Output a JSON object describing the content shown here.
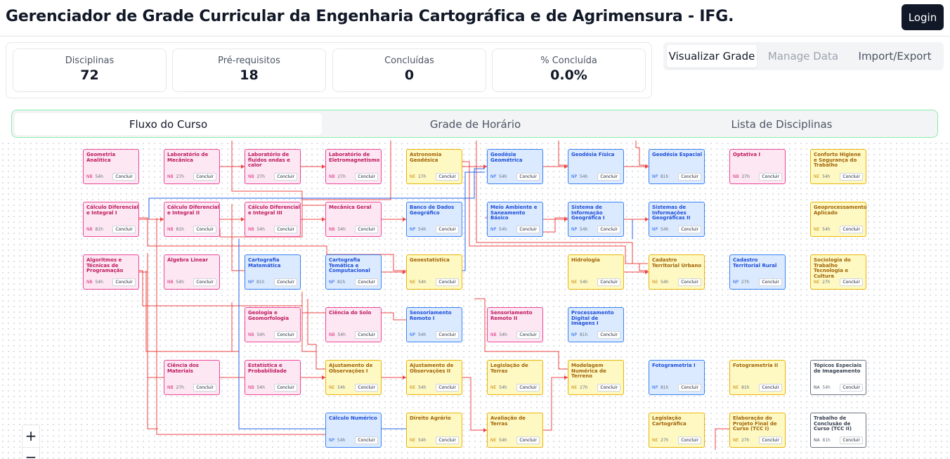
{
  "header": {
    "title": "Gerenciador de Grade Curricular da Engenharia Cartográfica e de Agrimensura - IFG.",
    "login_label": "Login"
  },
  "stats": [
    {
      "label": "Disciplinas",
      "value": "72"
    },
    {
      "label": "Pré-requisitos",
      "value": "18"
    },
    {
      "label": "Concluídas",
      "value": "0"
    },
    {
      "label": "% Concluída",
      "value": "0.0%"
    }
  ],
  "top_tabs": [
    {
      "label": "Visualizar Grade",
      "state": "active"
    },
    {
      "label": "Manage Data",
      "state": "disabled"
    },
    {
      "label": "Import/Export",
      "state": "normal"
    }
  ],
  "sub_tabs": [
    {
      "label": "Fluxo do Curso",
      "active": true
    },
    {
      "label": "Grade de Horário",
      "active": false
    },
    {
      "label": "Lista de Disciplinas",
      "active": false
    }
  ],
  "node_button_label": "Concluir",
  "zoom": {
    "in_label": "+",
    "out_label": "−"
  },
  "colors": {
    "NB": "#ec4899",
    "NP": "#3b82f6",
    "NE": "#eab308",
    "NA": "#6b7280",
    "edge_red": "#ef4444",
    "edge_blue": "#2563eb"
  },
  "columns": [
    [
      {
        "row": 0,
        "name": "Geometria Analítica",
        "code": "NB",
        "hours": "54h"
      },
      {
        "row": 1,
        "name": "Cálculo Diferencial e Integral I",
        "code": "NB",
        "hours": "81h"
      },
      {
        "row": 2,
        "name": "Algoritmos e Técnicas de Programação",
        "code": "NB",
        "hours": "54h"
      }
    ],
    [
      {
        "row": 0,
        "name": "Laboratório de Mecânica",
        "code": "NB",
        "hours": "27h"
      },
      {
        "row": 1,
        "name": "Cálculo Diferencial e Integral II",
        "code": "NB",
        "hours": "81h"
      },
      {
        "row": 2,
        "name": "Álgebra Linear",
        "code": "NB",
        "hours": "54h"
      },
      {
        "row": 4,
        "name": "Ciência dos Materiais",
        "code": "NB",
        "hours": "27h"
      }
    ],
    [
      {
        "row": 0,
        "name": "Laboratório de fluidos ondas e calor",
        "code": "NB",
        "hours": "27h"
      },
      {
        "row": 1,
        "name": "Cálculo Diferencial e Integral III",
        "code": "NB",
        "hours": "54h"
      },
      {
        "row": 2,
        "name": "Cartografia Matemática",
        "code": "NP",
        "hours": "81h"
      },
      {
        "row": 3,
        "name": "Geologia e Geomorfologia",
        "code": "NB",
        "hours": "54h"
      },
      {
        "row": 4,
        "name": "Estatística e Probabilidade",
        "code": "NB",
        "hours": "54h"
      }
    ],
    [
      {
        "row": 0,
        "name": "Laboratório de Eletromagnetismo",
        "code": "NB",
        "hours": "27h"
      },
      {
        "row": 1,
        "name": "Mecânica Geral",
        "code": "NB",
        "hours": "54h"
      },
      {
        "row": 2,
        "name": "Cartografia Temática e Computacional",
        "code": "NP",
        "hours": "81h"
      },
      {
        "row": 3,
        "name": "Ciência do Solo",
        "code": "NB",
        "hours": "54h"
      },
      {
        "row": 4,
        "name": "Ajustamento de Observações I",
        "code": "NE",
        "hours": "54h"
      },
      {
        "row": 5,
        "name": "Cálculo Numérico",
        "code": "NP",
        "hours": "54h"
      }
    ],
    [
      {
        "row": 0,
        "name": "Astronomia Geodésica",
        "code": "NE",
        "hours": "27h"
      },
      {
        "row": 1,
        "name": "Banco de Dados Geográfico",
        "code": "NP",
        "hours": "54h"
      },
      {
        "row": 2,
        "name": "Geoestatística",
        "code": "NE",
        "hours": "54h"
      },
      {
        "row": 3,
        "name": "Sensoriamento Remoto I",
        "code": "NP",
        "hours": "54h"
      },
      {
        "row": 4,
        "name": "Ajustamento de Observações II",
        "code": "NE",
        "hours": "54h"
      },
      {
        "row": 5,
        "name": "Direito Agrário",
        "code": "NE",
        "hours": "54h"
      }
    ],
    [
      {
        "row": 0,
        "name": "Geodésia Geométrica",
        "code": "NP",
        "hours": "54h"
      },
      {
        "row": 1,
        "name": "Meio Ambiente e Saneamento Básico",
        "code": "NP",
        "hours": "54h"
      },
      {
        "row": 3,
        "name": "Sensoriamento Remoto II",
        "code": "NB",
        "hours": "54h"
      },
      {
        "row": 4,
        "name": "Legislação de Terras",
        "code": "NE",
        "hours": "54h"
      },
      {
        "row": 5,
        "name": "Avaliação de Terras",
        "code": "NE",
        "hours": "54h"
      }
    ],
    [
      {
        "row": 0,
        "name": "Geodésia Física",
        "code": "NP",
        "hours": "54h"
      },
      {
        "row": 1,
        "name": "Sistema de Informação Geográfica I",
        "code": "NP",
        "hours": "54h"
      },
      {
        "row": 2,
        "name": "Hidrologia",
        "code": "NE",
        "hours": "54h"
      },
      {
        "row": 3,
        "name": "Processamento Digital de Imagens I",
        "code": "NP",
        "hours": "81h"
      },
      {
        "row": 4,
        "name": "Modelagem Numérica de Terreno",
        "code": "NE",
        "hours": "27h"
      }
    ],
    [
      {
        "row": 0,
        "name": "Geodésia Espacial",
        "code": "NP",
        "hours": "81h"
      },
      {
        "row": 1,
        "name": "Sistemas de Informações Geográficas II",
        "code": "NP",
        "hours": "54h"
      },
      {
        "row": 2,
        "name": "Cadastro Territorial Urbano",
        "code": "NE",
        "hours": "54h"
      },
      {
        "row": 4,
        "name": "Fotogrametria I",
        "code": "NP",
        "hours": "81h"
      },
      {
        "row": 5,
        "name": "Legislação Cartográfica",
        "code": "NE",
        "hours": "27h"
      }
    ],
    [
      {
        "row": 0,
        "name": "Optativa I",
        "code": "NB",
        "hours": "27h"
      },
      {
        "row": 2,
        "name": "Cadastro Territorial Rural",
        "code": "NP",
        "hours": "27h"
      },
      {
        "row": 4,
        "name": "Fotogrametria II",
        "code": "NE",
        "hours": "81h"
      },
      {
        "row": 5,
        "name": "Elaboração do Projeto Final de Curso (TCC I)",
        "code": "NE",
        "hours": "27h"
      }
    ],
    [
      {
        "row": 0,
        "name": "Conforto Higiene e Segurança do Trabalho",
        "code": "NE",
        "hours": "54h"
      },
      {
        "row": 1,
        "name": "Geoprocessamento Aplicado",
        "code": "NE",
        "hours": "54h"
      },
      {
        "row": 2,
        "name": "Sociologia do Trabalho Tecnologia e Cultura",
        "code": "NE",
        "hours": "27h"
      },
      {
        "row": 4,
        "name": "Tópicos Especiais de Imageamento",
        "code": "NA",
        "hours": "54h"
      },
      {
        "row": 5,
        "name": "Trabalho de Conclusão de Curso (TCC II)",
        "code": "NA",
        "hours": "81h"
      }
    ]
  ],
  "edges": [
    {
      "from": [
        0,
        1
      ],
      "to": [
        1,
        1
      ]
    },
    {
      "from": [
        1,
        1
      ],
      "to": [
        2,
        1
      ]
    },
    {
      "from": [
        2,
        1
      ],
      "to": [
        3,
        1
      ]
    },
    {
      "from": [
        1,
        0
      ],
      "to": [
        2,
        0
      ]
    },
    {
      "from": [
        2,
        0
      ],
      "to": [
        3,
        0
      ]
    },
    {
      "from": [
        3,
        1
      ],
      "to": [
        4,
        1
      ]
    },
    {
      "from": [
        4,
        0
      ],
      "to": [
        5,
        0
      ]
    },
    {
      "from": [
        5,
        0
      ],
      "to": [
        6,
        0
      ]
    },
    {
      "from": [
        6,
        0
      ],
      "to": [
        7,
        0
      ]
    },
    {
      "from": [
        5,
        1
      ],
      "to": [
        6,
        1
      ]
    },
    {
      "from": [
        6,
        1
      ],
      "to": [
        7,
        1
      ]
    },
    {
      "from": [
        3,
        2
      ],
      "to": [
        4,
        2
      ]
    },
    {
      "from": [
        3,
        4
      ],
      "to": [
        4,
        4
      ]
    },
    {
      "from": [
        4,
        4
      ],
      "to": [
        5,
        4
      ]
    },
    {
      "from": [
        5,
        4
      ],
      "to": [
        6,
        4
      ]
    },
    {
      "from": [
        8,
        5
      ],
      "to": [
        9,
        5
      ]
    },
    {
      "from": [
        6,
        2
      ],
      "to": [
        7,
        2
      ]
    },
    {
      "from": [
        0,
        2
      ],
      "to": [
        3,
        4
      ]
    }
  ]
}
